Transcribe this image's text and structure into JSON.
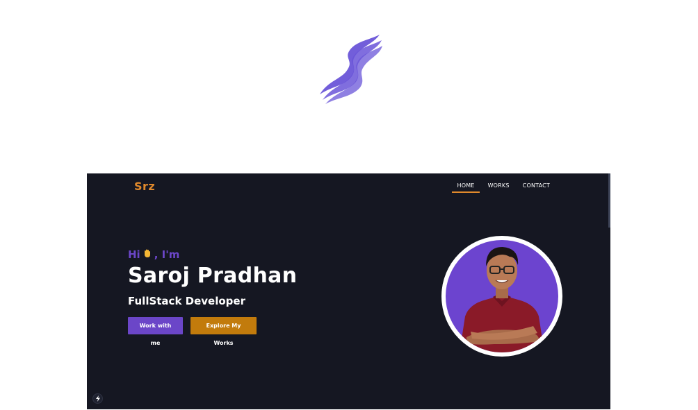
{
  "brand": {
    "logo_icon": "wave-s-logo",
    "accent": "#6b52d6"
  },
  "site": {
    "logo": "Srz",
    "logo_color": "#e0892c",
    "background": "#151722",
    "nav": [
      {
        "label": "HOME",
        "active": true
      },
      {
        "label": "WORKS",
        "active": false
      },
      {
        "label": "CONTACT",
        "active": false
      }
    ],
    "hero": {
      "greeting_prefix": "Hi",
      "greeting_icon": "waving-hand-icon",
      "greeting_suffix": ", I'm",
      "name": "Saroj Pradhan",
      "role": "FullStack Developer",
      "primary_button": "Work with me",
      "secondary_button": "Explore My Works"
    },
    "avatar": {
      "icon": "profile-photo",
      "ring_color": "#ffffff",
      "bg_color": "#6c44cf"
    },
    "floating_button_icon": "lightning-bolt-icon"
  }
}
